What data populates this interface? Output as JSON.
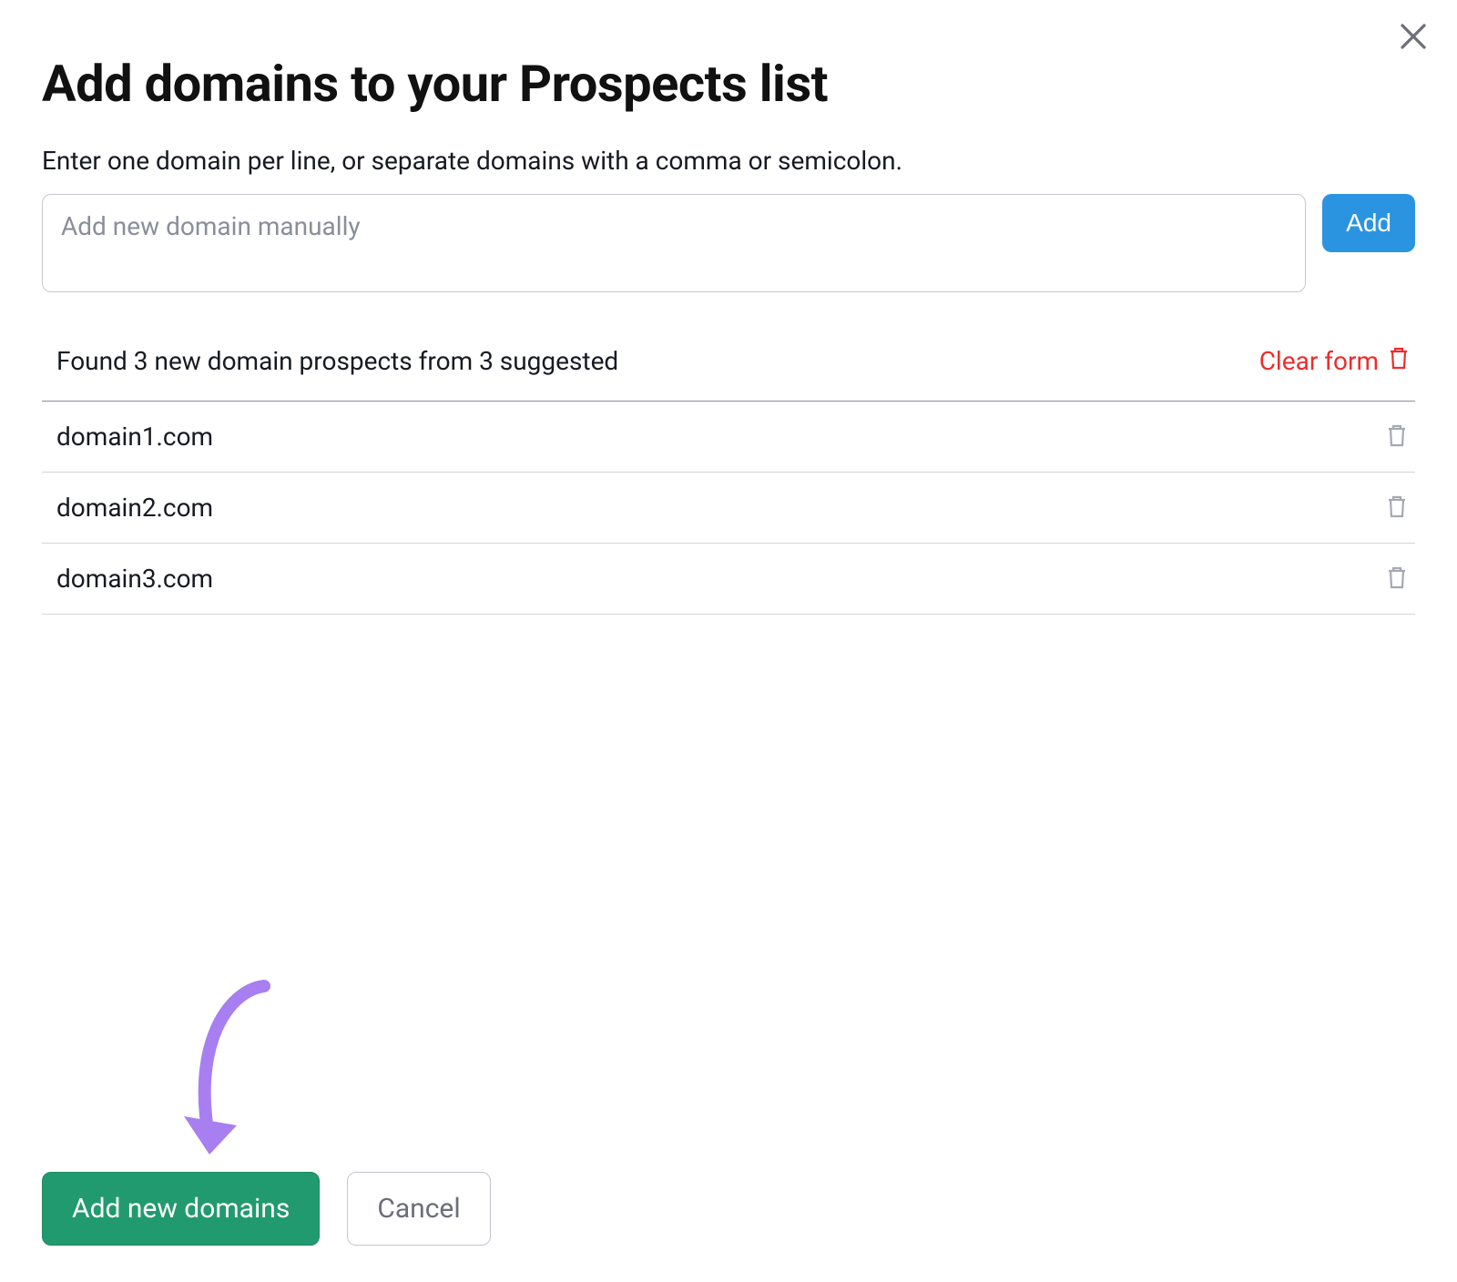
{
  "modal": {
    "title": "Add domains to your Prospects list",
    "subtext": "Enter one domain per line, or separate domains with a comma or semicolon.",
    "input_placeholder": "Add new domain manually",
    "add_button": "Add",
    "found_text": "Found 3 new domain prospects from 3 suggested",
    "clear_form_label": "Clear form",
    "domains": [
      {
        "name": "domain1.com"
      },
      {
        "name": "domain2.com"
      },
      {
        "name": "domain3.com"
      }
    ],
    "footer": {
      "primary": "Add new domains",
      "cancel": "Cancel"
    }
  },
  "colors": {
    "primary_blue": "#2b94e1",
    "primary_green": "#219a6f",
    "danger_red": "#ed2d2d",
    "annotation_purple": "#a87ff0"
  }
}
